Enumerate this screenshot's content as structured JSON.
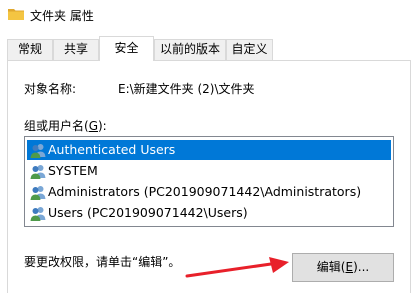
{
  "window": {
    "title": "文件夹 属性"
  },
  "tabs": [
    {
      "label": "常规"
    },
    {
      "label": "共享"
    },
    {
      "label": "安全"
    },
    {
      "label": "以前的版本"
    },
    {
      "label": "自定义"
    }
  ],
  "security": {
    "object_name_label": "对象名称:",
    "object_name_value": "E:\\新建文件夹 (2)\\文件夹",
    "group_label_prefix": "组或用户名(",
    "group_label_key": "G",
    "group_label_suffix": "):",
    "users": [
      {
        "name": "Authenticated Users",
        "selected": true
      },
      {
        "name": "SYSTEM",
        "selected": false
      },
      {
        "name": "Administrators (PC201909071442\\Administrators)",
        "selected": false
      },
      {
        "name": "Users (PC201909071442\\Users)",
        "selected": false
      }
    ],
    "change_hint": "要更改权限，请单击“编辑”。",
    "edit_button_prefix": "编辑(",
    "edit_button_key": "E",
    "edit_button_suffix": ")..."
  },
  "colors": {
    "selection": "#0078d7",
    "arrow": "#e8202a",
    "folder": "#f4c542"
  },
  "icons": {
    "window": "folder-icon",
    "user": "user-group-icon",
    "pointer": "red-arrow"
  }
}
